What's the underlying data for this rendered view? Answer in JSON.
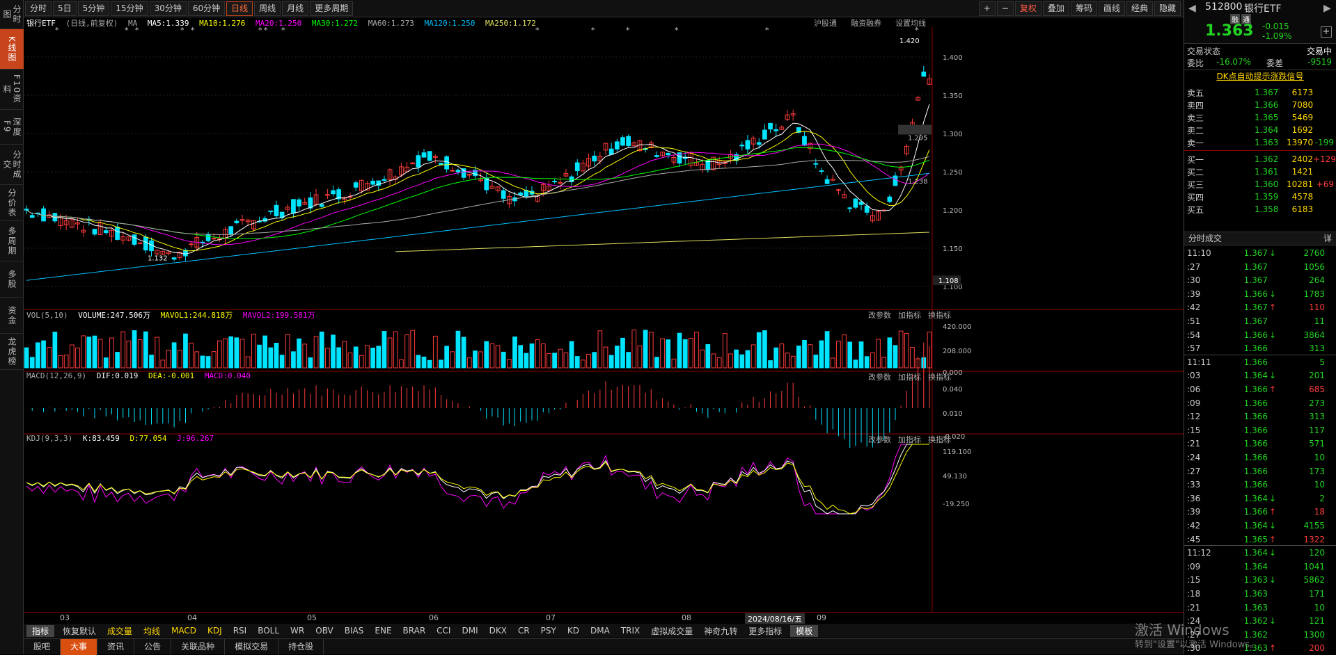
{
  "left_rail": [
    "分时图",
    "K线图",
    "F10资料",
    "深度F9",
    "分时成交",
    "分价表",
    "多周期",
    "多股",
    "资金",
    "龙虎榜"
  ],
  "toolbar": {
    "periods": [
      "分时",
      "5日",
      "5分钟",
      "15分钟",
      "30分钟",
      "60分钟",
      "日线",
      "周线",
      "月线",
      "更多周期"
    ],
    "active_period": "日线",
    "right": [
      "+",
      "−",
      "复权",
      "叠加",
      "筹码",
      "画线",
      "经典",
      "隐藏"
    ]
  },
  "chart_info": {
    "name": "银行ETF",
    "mode": "(日线,前复权)",
    "ma_label": "MA",
    "ma5": "MA5:1.339",
    "ma10": "MA10:1.276",
    "ma20": "MA20:1.250",
    "ma30": "MA30:1.272",
    "ma60": "MA60:1.273",
    "ma120": "MA120:1.250",
    "ma250": "MA250:1.172",
    "links": [
      "沪股通",
      "融资融券",
      "设置均线"
    ]
  },
  "price_axis": [
    "1.400",
    "1.350",
    "1.300",
    "1.250",
    "1.200",
    "1.150",
    "1.100"
  ],
  "price_marks": {
    "high": "1.420",
    "low": "1.132",
    "cursor": "1.108",
    "box1": "1.295",
    "box2": "1.238"
  },
  "volume": {
    "label": "VOL(5,10)",
    "volume": "VOLUME:247.506万",
    "mavol1": "MAVOL1:244.818万",
    "mavol2": "MAVOL2:199.581万",
    "axis": [
      "420.000",
      "208.000",
      "0.000"
    ]
  },
  "macd": {
    "label": "MACD(12,26,9)",
    "dif": "DIF:0.019",
    "dea": "DEA:-0.001",
    "macd": "MACD:0.040",
    "axis": [
      "0.040",
      "0.010",
      "-0.020"
    ]
  },
  "kdj": {
    "label": "KDJ(9,3,3)",
    "k": "K:83.459",
    "d": "D:77.054",
    "j": "J:96.267",
    "axis": [
      "119.100",
      "49.130",
      "-19.250"
    ]
  },
  "pane_actions": [
    "改参数",
    "加指标",
    "换指标"
  ],
  "x_axis": [
    "03",
    "04",
    "05",
    "06",
    "07",
    "08",
    "09"
  ],
  "x_cursor": "2024/08/16/五",
  "indicator_bar": {
    "label": "指标",
    "items": [
      "恢复默认",
      "成交量",
      "均线",
      "MACD",
      "KDJ",
      "RSI",
      "BOLL",
      "WR",
      "OBV",
      "BIAS",
      "ENE",
      "BRAR",
      "CCI",
      "DMI",
      "DKX",
      "CR",
      "PSY",
      "KD",
      "DMA",
      "TRIX",
      "虚拟成交量",
      "神奇九转",
      "更多指标"
    ],
    "highlighted": [
      "成交量",
      "均线",
      "MACD",
      "KDJ"
    ],
    "template": "模板"
  },
  "bottom_tabs": [
    "股吧",
    "大事",
    "资讯",
    "公告",
    "关联品种",
    "模拟交易",
    "持仓股"
  ],
  "active_bottom_tab": "大事",
  "quote": {
    "code": "512800",
    "name": "银行ETF",
    "tags": [
      "融",
      "通"
    ],
    "price": "1.363",
    "change": "-0.015",
    "change_pct": "-1.09%",
    "status_label": "交易状态",
    "status": "交易中",
    "weibi_label": "委比",
    "weibi": "-16.07%",
    "weicha_label": "委差",
    "weicha": "-9519",
    "signal": "DK点自动提示涨跌信号",
    "asks": [
      {
        "label": "卖五",
        "price": "1.367",
        "vol": "6173",
        "chg": ""
      },
      {
        "label": "卖四",
        "price": "1.366",
        "vol": "7080",
        "chg": ""
      },
      {
        "label": "卖三",
        "price": "1.365",
        "vol": "5469",
        "chg": ""
      },
      {
        "label": "卖二",
        "price": "1.364",
        "vol": "1692",
        "chg": ""
      },
      {
        "label": "卖一",
        "price": "1.363",
        "vol": "13970",
        "chg": "-199"
      }
    ],
    "bids": [
      {
        "label": "买一",
        "price": "1.362",
        "vol": "2402",
        "chg": "+129"
      },
      {
        "label": "买二",
        "price": "1.361",
        "vol": "1421",
        "chg": ""
      },
      {
        "label": "买三",
        "price": "1.360",
        "vol": "10281",
        "chg": "+69"
      },
      {
        "label": "买四",
        "price": "1.359",
        "vol": "4578",
        "chg": ""
      },
      {
        "label": "买五",
        "price": "1.358",
        "vol": "6183",
        "chg": ""
      }
    ]
  },
  "trades_header": "分时成交",
  "trades_detail": "详",
  "trades": [
    {
      "t": "11:10",
      "p": "1.367",
      "d": "dn",
      "v": "2760"
    },
    {
      "t": ":27",
      "p": "1.367",
      "d": "",
      "v": "1056"
    },
    {
      "t": ":30",
      "p": "1.367",
      "d": "",
      "v": "264"
    },
    {
      "t": ":39",
      "p": "1.366",
      "d": "dn",
      "v": "1783"
    },
    {
      "t": ":42",
      "p": "1.367",
      "d": "up",
      "v": "110"
    },
    {
      "t": ":51",
      "p": "1.367",
      "d": "",
      "v": "11"
    },
    {
      "t": ":54",
      "p": "1.366",
      "d": "dn",
      "v": "3864"
    },
    {
      "t": ":57",
      "p": "1.366",
      "d": "",
      "v": "313"
    },
    {
      "t": "11:11",
      "p": "1.366",
      "d": "",
      "v": "5"
    },
    {
      "t": ":03",
      "p": "1.364",
      "d": "dn",
      "v": "201"
    },
    {
      "t": ":06",
      "p": "1.366",
      "d": "up",
      "v": "685"
    },
    {
      "t": ":09",
      "p": "1.366",
      "d": "",
      "v": "273"
    },
    {
      "t": ":12",
      "p": "1.366",
      "d": "",
      "v": "313"
    },
    {
      "t": ":15",
      "p": "1.366",
      "d": "",
      "v": "117"
    },
    {
      "t": ":21",
      "p": "1.366",
      "d": "",
      "v": "571"
    },
    {
      "t": ":24",
      "p": "1.366",
      "d": "",
      "v": "10"
    },
    {
      "t": ":27",
      "p": "1.366",
      "d": "",
      "v": "173"
    },
    {
      "t": ":33",
      "p": "1.366",
      "d": "",
      "v": "10"
    },
    {
      "t": ":36",
      "p": "1.364",
      "d": "dn",
      "v": "2"
    },
    {
      "t": ":39",
      "p": "1.366",
      "d": "up",
      "v": "18"
    },
    {
      "t": ":42",
      "p": "1.364",
      "d": "dn",
      "v": "4155"
    },
    {
      "t": ":45",
      "p": "1.365",
      "d": "up",
      "v": "1322"
    },
    {
      "t": "11:12",
      "p": "1.364",
      "d": "dn",
      "v": "120"
    },
    {
      "t": ":09",
      "p": "1.364",
      "d": "",
      "v": "1041"
    },
    {
      "t": ":15",
      "p": "1.363",
      "d": "dn",
      "v": "5862"
    },
    {
      "t": ":18",
      "p": "1.363",
      "d": "",
      "v": "171"
    },
    {
      "t": ":21",
      "p": "1.363",
      "d": "",
      "v": "10"
    },
    {
      "t": ":24",
      "p": "1.362",
      "d": "dn",
      "v": "121"
    },
    {
      "t": ":27",
      "p": "1.362",
      "d": "",
      "v": "1300"
    },
    {
      "t": ":30",
      "p": "1.363",
      "d": "up",
      "v": "200"
    }
  ],
  "watermark": {
    "line1": "激活 Windows",
    "line2": "转到\"设置\"以激活 Windows。"
  },
  "colors": {
    "up": "#ff3b3b",
    "down": "#00e5ff",
    "ma5": "#ffffff",
    "ma10": "#ffff00",
    "ma20": "#ff00ff",
    "ma30": "#00ff00",
    "ma60": "#aaaaaa",
    "ma120": "#00bfff",
    "ma250": "#e0e060",
    "accent": "#c8451c"
  }
}
